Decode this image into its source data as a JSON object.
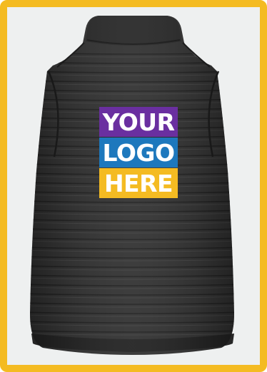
{
  "image": {
    "subject": "black-quilted-gilet-back-view",
    "frame_color": "#f4bb22",
    "background_color": "#eef0f0",
    "garment_color": "#353535"
  },
  "logo": {
    "lines": [
      "YOUR",
      "LOGO",
      "HERE"
    ],
    "colors": [
      "#6a2fa0",
      "#1d78bd",
      "#f4bb22"
    ]
  }
}
